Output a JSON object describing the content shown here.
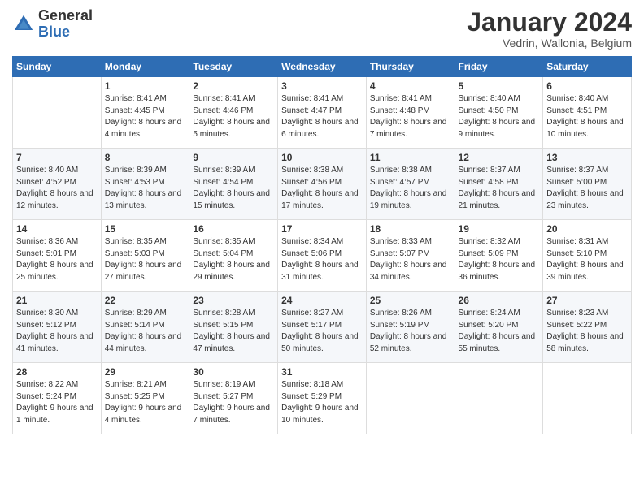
{
  "logo": {
    "general": "General",
    "blue": "Blue"
  },
  "header": {
    "title": "January 2024",
    "location": "Vedrin, Wallonia, Belgium"
  },
  "days_of_week": [
    "Sunday",
    "Monday",
    "Tuesday",
    "Wednesday",
    "Thursday",
    "Friday",
    "Saturday"
  ],
  "weeks": [
    [
      {
        "day": "",
        "sunrise": "",
        "sunset": "",
        "daylight": ""
      },
      {
        "day": "1",
        "sunrise": "Sunrise: 8:41 AM",
        "sunset": "Sunset: 4:45 PM",
        "daylight": "Daylight: 8 hours and 4 minutes."
      },
      {
        "day": "2",
        "sunrise": "Sunrise: 8:41 AM",
        "sunset": "Sunset: 4:46 PM",
        "daylight": "Daylight: 8 hours and 5 minutes."
      },
      {
        "day": "3",
        "sunrise": "Sunrise: 8:41 AM",
        "sunset": "Sunset: 4:47 PM",
        "daylight": "Daylight: 8 hours and 6 minutes."
      },
      {
        "day": "4",
        "sunrise": "Sunrise: 8:41 AM",
        "sunset": "Sunset: 4:48 PM",
        "daylight": "Daylight: 8 hours and 7 minutes."
      },
      {
        "day": "5",
        "sunrise": "Sunrise: 8:40 AM",
        "sunset": "Sunset: 4:50 PM",
        "daylight": "Daylight: 8 hours and 9 minutes."
      },
      {
        "day": "6",
        "sunrise": "Sunrise: 8:40 AM",
        "sunset": "Sunset: 4:51 PM",
        "daylight": "Daylight: 8 hours and 10 minutes."
      }
    ],
    [
      {
        "day": "7",
        "sunrise": "Sunrise: 8:40 AM",
        "sunset": "Sunset: 4:52 PM",
        "daylight": "Daylight: 8 hours and 12 minutes."
      },
      {
        "day": "8",
        "sunrise": "Sunrise: 8:39 AM",
        "sunset": "Sunset: 4:53 PM",
        "daylight": "Daylight: 8 hours and 13 minutes."
      },
      {
        "day": "9",
        "sunrise": "Sunrise: 8:39 AM",
        "sunset": "Sunset: 4:54 PM",
        "daylight": "Daylight: 8 hours and 15 minutes."
      },
      {
        "day": "10",
        "sunrise": "Sunrise: 8:38 AM",
        "sunset": "Sunset: 4:56 PM",
        "daylight": "Daylight: 8 hours and 17 minutes."
      },
      {
        "day": "11",
        "sunrise": "Sunrise: 8:38 AM",
        "sunset": "Sunset: 4:57 PM",
        "daylight": "Daylight: 8 hours and 19 minutes."
      },
      {
        "day": "12",
        "sunrise": "Sunrise: 8:37 AM",
        "sunset": "Sunset: 4:58 PM",
        "daylight": "Daylight: 8 hours and 21 minutes."
      },
      {
        "day": "13",
        "sunrise": "Sunrise: 8:37 AM",
        "sunset": "Sunset: 5:00 PM",
        "daylight": "Daylight: 8 hours and 23 minutes."
      }
    ],
    [
      {
        "day": "14",
        "sunrise": "Sunrise: 8:36 AM",
        "sunset": "Sunset: 5:01 PM",
        "daylight": "Daylight: 8 hours and 25 minutes."
      },
      {
        "day": "15",
        "sunrise": "Sunrise: 8:35 AM",
        "sunset": "Sunset: 5:03 PM",
        "daylight": "Daylight: 8 hours and 27 minutes."
      },
      {
        "day": "16",
        "sunrise": "Sunrise: 8:35 AM",
        "sunset": "Sunset: 5:04 PM",
        "daylight": "Daylight: 8 hours and 29 minutes."
      },
      {
        "day": "17",
        "sunrise": "Sunrise: 8:34 AM",
        "sunset": "Sunset: 5:06 PM",
        "daylight": "Daylight: 8 hours and 31 minutes."
      },
      {
        "day": "18",
        "sunrise": "Sunrise: 8:33 AM",
        "sunset": "Sunset: 5:07 PM",
        "daylight": "Daylight: 8 hours and 34 minutes."
      },
      {
        "day": "19",
        "sunrise": "Sunrise: 8:32 AM",
        "sunset": "Sunset: 5:09 PM",
        "daylight": "Daylight: 8 hours and 36 minutes."
      },
      {
        "day": "20",
        "sunrise": "Sunrise: 8:31 AM",
        "sunset": "Sunset: 5:10 PM",
        "daylight": "Daylight: 8 hours and 39 minutes."
      }
    ],
    [
      {
        "day": "21",
        "sunrise": "Sunrise: 8:30 AM",
        "sunset": "Sunset: 5:12 PM",
        "daylight": "Daylight: 8 hours and 41 minutes."
      },
      {
        "day": "22",
        "sunrise": "Sunrise: 8:29 AM",
        "sunset": "Sunset: 5:14 PM",
        "daylight": "Daylight: 8 hours and 44 minutes."
      },
      {
        "day": "23",
        "sunrise": "Sunrise: 8:28 AM",
        "sunset": "Sunset: 5:15 PM",
        "daylight": "Daylight: 8 hours and 47 minutes."
      },
      {
        "day": "24",
        "sunrise": "Sunrise: 8:27 AM",
        "sunset": "Sunset: 5:17 PM",
        "daylight": "Daylight: 8 hours and 50 minutes."
      },
      {
        "day": "25",
        "sunrise": "Sunrise: 8:26 AM",
        "sunset": "Sunset: 5:19 PM",
        "daylight": "Daylight: 8 hours and 52 minutes."
      },
      {
        "day": "26",
        "sunrise": "Sunrise: 8:24 AM",
        "sunset": "Sunset: 5:20 PM",
        "daylight": "Daylight: 8 hours and 55 minutes."
      },
      {
        "day": "27",
        "sunrise": "Sunrise: 8:23 AM",
        "sunset": "Sunset: 5:22 PM",
        "daylight": "Daylight: 8 hours and 58 minutes."
      }
    ],
    [
      {
        "day": "28",
        "sunrise": "Sunrise: 8:22 AM",
        "sunset": "Sunset: 5:24 PM",
        "daylight": "Daylight: 9 hours and 1 minute."
      },
      {
        "day": "29",
        "sunrise": "Sunrise: 8:21 AM",
        "sunset": "Sunset: 5:25 PM",
        "daylight": "Daylight: 9 hours and 4 minutes."
      },
      {
        "day": "30",
        "sunrise": "Sunrise: 8:19 AM",
        "sunset": "Sunset: 5:27 PM",
        "daylight": "Daylight: 9 hours and 7 minutes."
      },
      {
        "day": "31",
        "sunrise": "Sunrise: 8:18 AM",
        "sunset": "Sunset: 5:29 PM",
        "daylight": "Daylight: 9 hours and 10 minutes."
      },
      {
        "day": "",
        "sunrise": "",
        "sunset": "",
        "daylight": ""
      },
      {
        "day": "",
        "sunrise": "",
        "sunset": "",
        "daylight": ""
      },
      {
        "day": "",
        "sunrise": "",
        "sunset": "",
        "daylight": ""
      }
    ]
  ]
}
